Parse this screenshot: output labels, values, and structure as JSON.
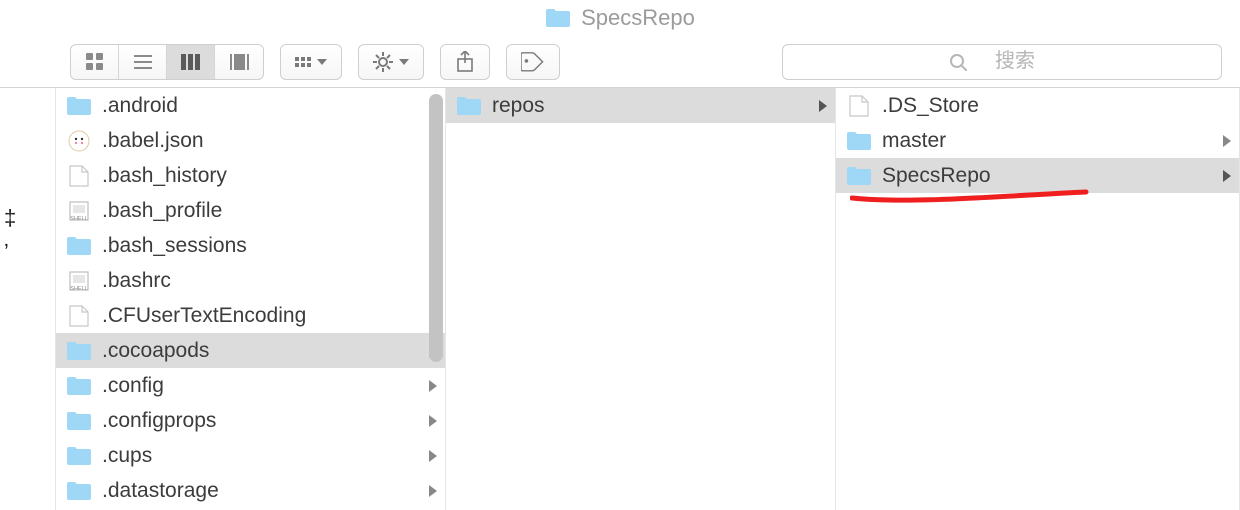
{
  "window": {
    "title": "SpecsRepo"
  },
  "toolbar": {
    "search_placeholder": "搜索"
  },
  "gutter": {
    "line1": "‡",
    "line2": "ʼ"
  },
  "col1": {
    "items": [
      {
        "name": ".android",
        "type": "folder",
        "has_children": true,
        "selected": false
      },
      {
        "name": ".babel.json",
        "type": "json",
        "has_children": false,
        "selected": false
      },
      {
        "name": ".bash_history",
        "type": "file",
        "has_children": false,
        "selected": false
      },
      {
        "name": ".bash_profile",
        "type": "shell",
        "has_children": false,
        "selected": false
      },
      {
        "name": ".bash_sessions",
        "type": "folder",
        "has_children": true,
        "selected": false
      },
      {
        "name": ".bashrc",
        "type": "shell",
        "has_children": false,
        "selected": false
      },
      {
        "name": ".CFUserTextEncoding",
        "type": "file",
        "has_children": false,
        "selected": false
      },
      {
        "name": ".cocoapods",
        "type": "folder",
        "has_children": true,
        "selected": true
      },
      {
        "name": ".config",
        "type": "folder",
        "has_children": true,
        "selected": false
      },
      {
        "name": ".configprops",
        "type": "folder",
        "has_children": true,
        "selected": false
      },
      {
        "name": ".cups",
        "type": "folder",
        "has_children": true,
        "selected": false
      },
      {
        "name": ".datastorage",
        "type": "folder",
        "has_children": true,
        "selected": false
      }
    ]
  },
  "col2": {
    "items": [
      {
        "name": "repos",
        "type": "folder",
        "has_children": true,
        "selected": true
      }
    ]
  },
  "col3": {
    "items": [
      {
        "name": ".DS_Store",
        "type": "file",
        "has_children": false,
        "selected": false
      },
      {
        "name": "master",
        "type": "folder",
        "has_children": true,
        "selected": false
      },
      {
        "name": "SpecsRepo",
        "type": "folder",
        "has_children": true,
        "selected": true
      }
    ]
  }
}
